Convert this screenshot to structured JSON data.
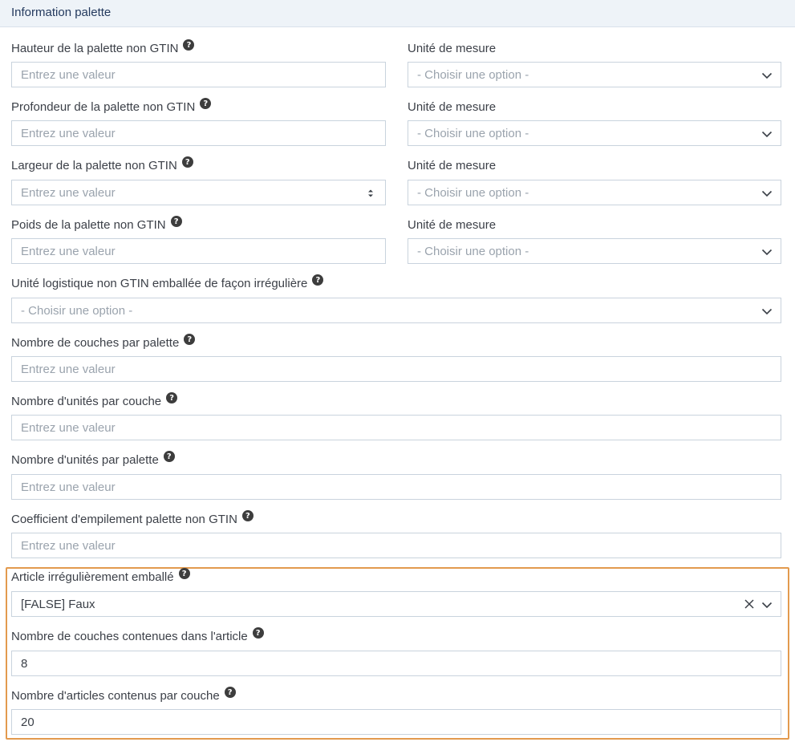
{
  "section": {
    "title": "Information palette"
  },
  "placeholder_input": "Entrez une valeur",
  "placeholder_select": "- Choisir une option -",
  "rows": {
    "hauteur": {
      "label": "Hauteur de la palette non GTIN",
      "unit_label": "Unité de mesure"
    },
    "profondeur": {
      "label": "Profondeur de la palette non GTIN",
      "unit_label": "Unité de mesure"
    },
    "largeur": {
      "label": "Largeur de la palette non GTIN",
      "unit_label": "Unité de mesure"
    },
    "poids": {
      "label": "Poids de la palette non GTIN",
      "unit_label": "Unité de mesure"
    }
  },
  "unite_logistique": {
    "label": "Unité logistique non GTIN emballée de façon irrégulière",
    "placeholder": "- Choisir une option -"
  },
  "couches_palette": {
    "label": "Nombre de couches par palette",
    "placeholder": "Entrez une valeur"
  },
  "unites_couche": {
    "label": "Nombre d'unités par couche",
    "placeholder": "Entrez une valeur"
  },
  "unites_palette": {
    "label": "Nombre d'unités par palette",
    "placeholder": "Entrez une valeur"
  },
  "coefficient": {
    "label": "Coefficient d'empilement palette non GTIN",
    "placeholder": "Entrez une valeur"
  },
  "article_irregulier": {
    "label": "Article irrégulièrement emballé",
    "value": "[FALSE] Faux"
  },
  "couches_article": {
    "label": "Nombre de couches contenues dans l'article",
    "value": "8"
  },
  "articles_couche": {
    "label": "Nombre d'articles contenus par couche",
    "value": "20"
  },
  "help_glyph": "?",
  "colors": {
    "highlight": "#e39a4e",
    "header_bg": "#eef3f8",
    "border": "#c9d3dd"
  }
}
